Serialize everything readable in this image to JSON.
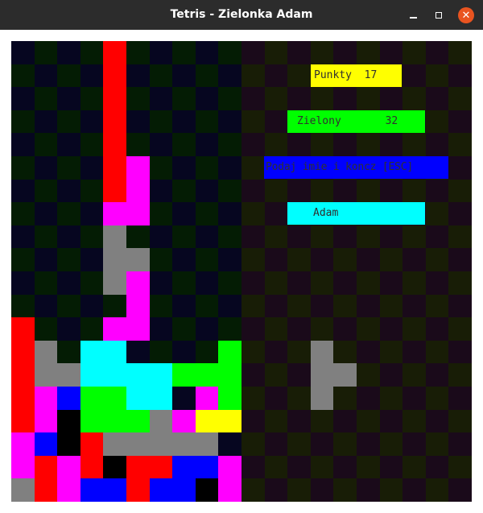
{
  "window": {
    "title": "Tetris - Zielonka Adam"
  },
  "colors": {
    "red": "#ff0000",
    "magenta": "#ff00ff",
    "gray": "#808080",
    "cyan": "#00ffff",
    "green": "#00ff00",
    "blue": "#0000ff",
    "yellow": "#ffff00",
    "black": "#000000",
    "board_dark_a": "#060620",
    "board_dark_b": "#041c04",
    "side_a": "#1a0a1a",
    "side_b": "#181d06"
  },
  "board": {
    "cols": 10,
    "rows": 20,
    "cells": [
      "....r.....",
      "....r.....",
      "....r.....",
      "....r.....",
      "....r.....",
      "....rm....",
      "....rm....",
      "....mm....",
      "....g.....",
      "....gg....",
      "....gm....",
      ".....m....",
      "r...mm....",
      "rg.cc....G",
      "rggccccGGG",
      "rmbGGcc.mGK",
      "rmKGGGgmYY",
      "mbKrggggg.",
      "mrmrKrrbbm",
      "grmbbrbbKm"
    ]
  },
  "next_piece": {
    "color": "gray",
    "cells": [
      [
        3,
        13
      ],
      [
        3,
        14
      ],
      [
        4,
        14
      ],
      [
        3,
        15
      ]
    ]
  },
  "panel": {
    "score_label": "Punkty  17",
    "player_label": "Zielony       32",
    "prompt_label": "Podaj imie i koncz [ESC]",
    "name_label": "Adam",
    "score_color": "#ffff00",
    "player_color": "#00ff00",
    "prompt_color": "#0000ff",
    "name_color": "#00ffff"
  }
}
